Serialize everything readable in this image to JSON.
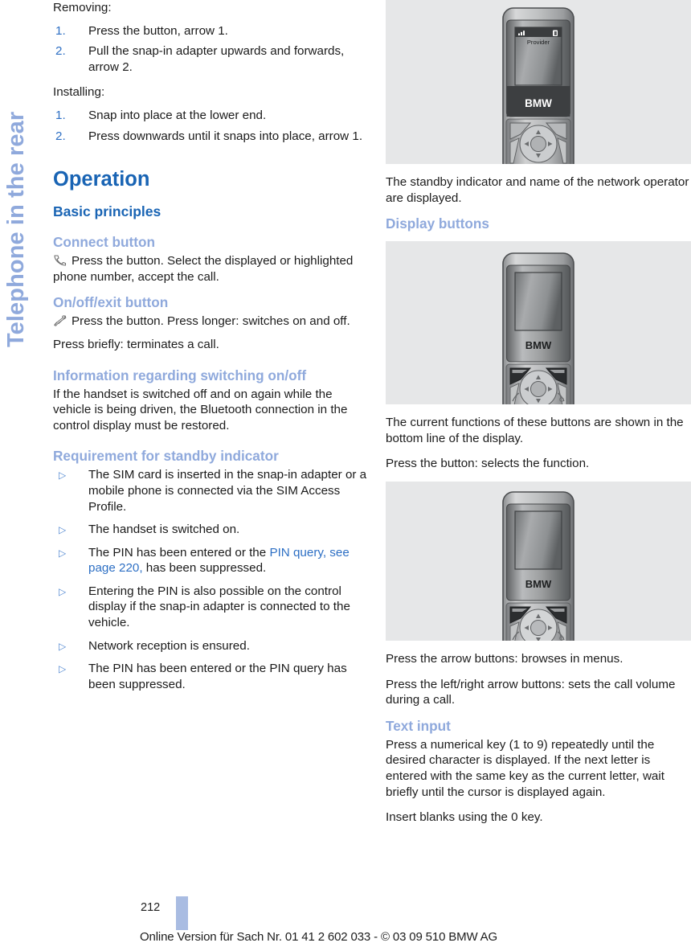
{
  "side_tab": {
    "label": "Telephone in the rear"
  },
  "left_column": {
    "removing": {
      "intro": "Removing:",
      "steps": [
        {
          "num": "1.",
          "text": "Press the button, arrow 1."
        },
        {
          "num": "2.",
          "text": "Pull the snap-in adapter upwards and forwards, arrow 2."
        }
      ]
    },
    "installing": {
      "intro": "Installing:",
      "steps": [
        {
          "num": "1.",
          "text": "Snap into place at the lower end."
        },
        {
          "num": "2.",
          "text": "Press downwards until it snaps into place, arrow 1."
        }
      ]
    },
    "section_title": "Operation",
    "sub_title": "Basic principles",
    "connect_button": {
      "heading": "Connect button",
      "icon": "call-handset-icon",
      "text": "Press the button. Select the displayed or highlighted phone number, accept the call."
    },
    "onoff_button": {
      "heading": "On/off/exit button",
      "icon": "end-call-handset-icon",
      "text": "Press the button. Press longer: switches on and off.",
      "text2": "Press briefly: terminates a call."
    },
    "switching_info": {
      "heading": "Information regarding switching on/off",
      "text": "If the handset is switched off and on again while the vehicle is being driven, the Bluetooth connection in the control display must be restored."
    },
    "standby_requirement": {
      "heading": "Requirement for standby indicator",
      "bullets": [
        {
          "text": "The SIM card is inserted in the snap-in adapter or a mobile phone is connected via the SIM Access Profile."
        },
        {
          "pre": "The PIN has been entered or the ",
          "link": "PIN query, see page 220,",
          "post": " has been suppressed."
        },
        {
          "text": "The handset is switched on."
        },
        {
          "text": "Entering the PIN is also possible on the control display if the snap-in adapter is connected to the vehicle."
        },
        {
          "text": "Network reception is ensured."
        },
        {
          "text": "The PIN has been entered or the PIN query has been suppressed."
        }
      ],
      "bullet_order": [
        0,
        2,
        1,
        3,
        4,
        5
      ]
    }
  },
  "right_column": {
    "figure1": {
      "name": "handset-standby-screen-figure",
      "screen_provider": "Provider",
      "brand": "BMW",
      "signal_icon": "signal-bars-icon",
      "battery_icon": "battery-icon"
    },
    "caption1": "The standby indicator and name of the network operator are displayed.",
    "display_buttons": {
      "heading": "Display buttons",
      "figure": {
        "name": "handset-display-buttons-figure",
        "brand": "BMW"
      },
      "text1": "The current functions of these buttons are shown in the bottom line of the display.",
      "text2": "Press the button: selects the function."
    },
    "arrow_buttons": {
      "figure": {
        "name": "handset-arrow-buttons-figure",
        "brand": "BMW"
      },
      "text1": "Press the arrow buttons: browses in menus.",
      "text2": "Press the left/right arrow buttons: sets the call volume during a call."
    },
    "text_input": {
      "heading": "Text input",
      "text1": "Press a numerical key (1 to 9) repeatedly until the desired character is displayed. If the next letter is entered with the same key as the current letter, wait briefly until the cursor is displayed again.",
      "text2": "Insert blanks using the 0 key."
    }
  },
  "footer": {
    "page_number": "212",
    "online_note": "Online Version für Sach Nr. 01 41 2 602 033 - © 03 09 510 BMW AG"
  },
  "colors": {
    "heading_blue": "#1964b4",
    "minor_blue": "#8fa9dc",
    "link_blue": "#2d6fc4",
    "figure_bg": "#e6e7e8",
    "page_bar": "#a9bce2"
  }
}
